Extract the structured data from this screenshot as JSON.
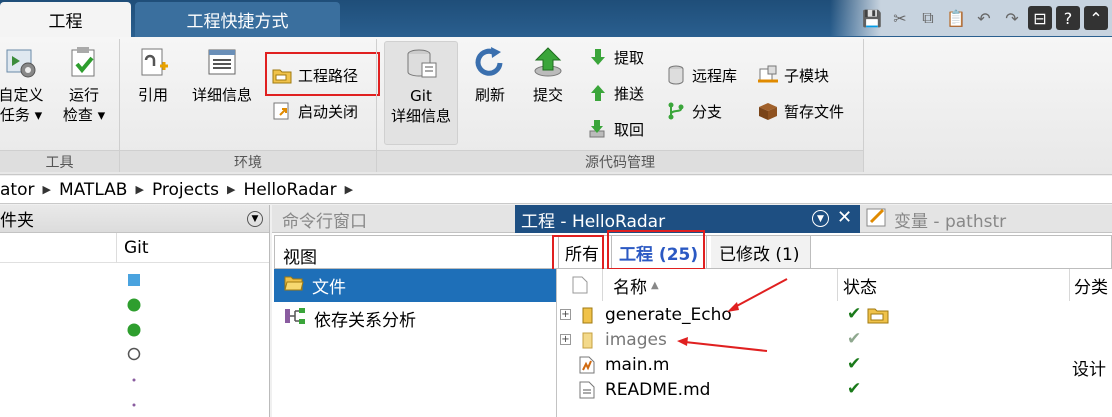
{
  "tabs": {
    "project": "工程",
    "shortcuts": "工程快捷方式"
  },
  "quick_access": [
    "save-icon",
    "cut-icon",
    "copy-icon",
    "paste-icon",
    "undo-icon",
    "redo-icon",
    "switch-window-icon",
    "help-icon",
    "collapse-icon"
  ],
  "ribbon": {
    "tools": {
      "custom_task": "自定义\n任务 ▾",
      "custom_task_l1": "自定义",
      "custom_task_l2": "任务 ▾",
      "run_check_l1": "运行",
      "run_check_l2": "检查 ▾",
      "group": "工具"
    },
    "env": {
      "references": "引用",
      "details": "详细信息",
      "project_path": "工程路径",
      "startup_shutdown": "启动关闭",
      "group": "环境"
    },
    "scm": {
      "git_details_l1": "Git",
      "git_details_l2": "详细信息",
      "refresh": "刷新",
      "commit": "提交",
      "fetch": "提取",
      "push": "推送",
      "pull": "取回",
      "remote": "远程库",
      "branches": "分支",
      "submodules": "子模块",
      "stash": "暂存文件",
      "group": "源代码管理"
    }
  },
  "breadcrumb": [
    "ator",
    "MATLAB",
    "Projects",
    "HelloRadar"
  ],
  "left_pane": {
    "title": "件夹",
    "col_git": "Git"
  },
  "right_pane": {
    "tab_command": "命令行窗口",
    "tab_project": "工程 - HelloRadar",
    "tab_variable": "变量 - pathstr"
  },
  "view_bar": {
    "label": "视图",
    "all": "所有",
    "project": "工程 (25)",
    "modified": "已修改 (1)"
  },
  "views": [
    {
      "label": "文件"
    },
    {
      "label": "依存关系分析"
    }
  ],
  "table": {
    "headers": {
      "name": "名称",
      "status": "状态",
      "category": "分类"
    },
    "rows": [
      {
        "name": "generate_Echo",
        "type": "folder",
        "expandable": true,
        "category": ""
      },
      {
        "name": "images",
        "type": "folder",
        "expandable": true,
        "category": ""
      },
      {
        "name": "main.m",
        "type": "m-file",
        "expandable": false,
        "category": "设计"
      },
      {
        "name": "README.md",
        "type": "md-file",
        "expandable": false,
        "category": ""
      }
    ]
  },
  "colors": {
    "accent_blue": "#1e4f82",
    "annotation_red": "#e02020",
    "git_added": "#4aa3df",
    "git_ok": "#2e9e2e"
  }
}
